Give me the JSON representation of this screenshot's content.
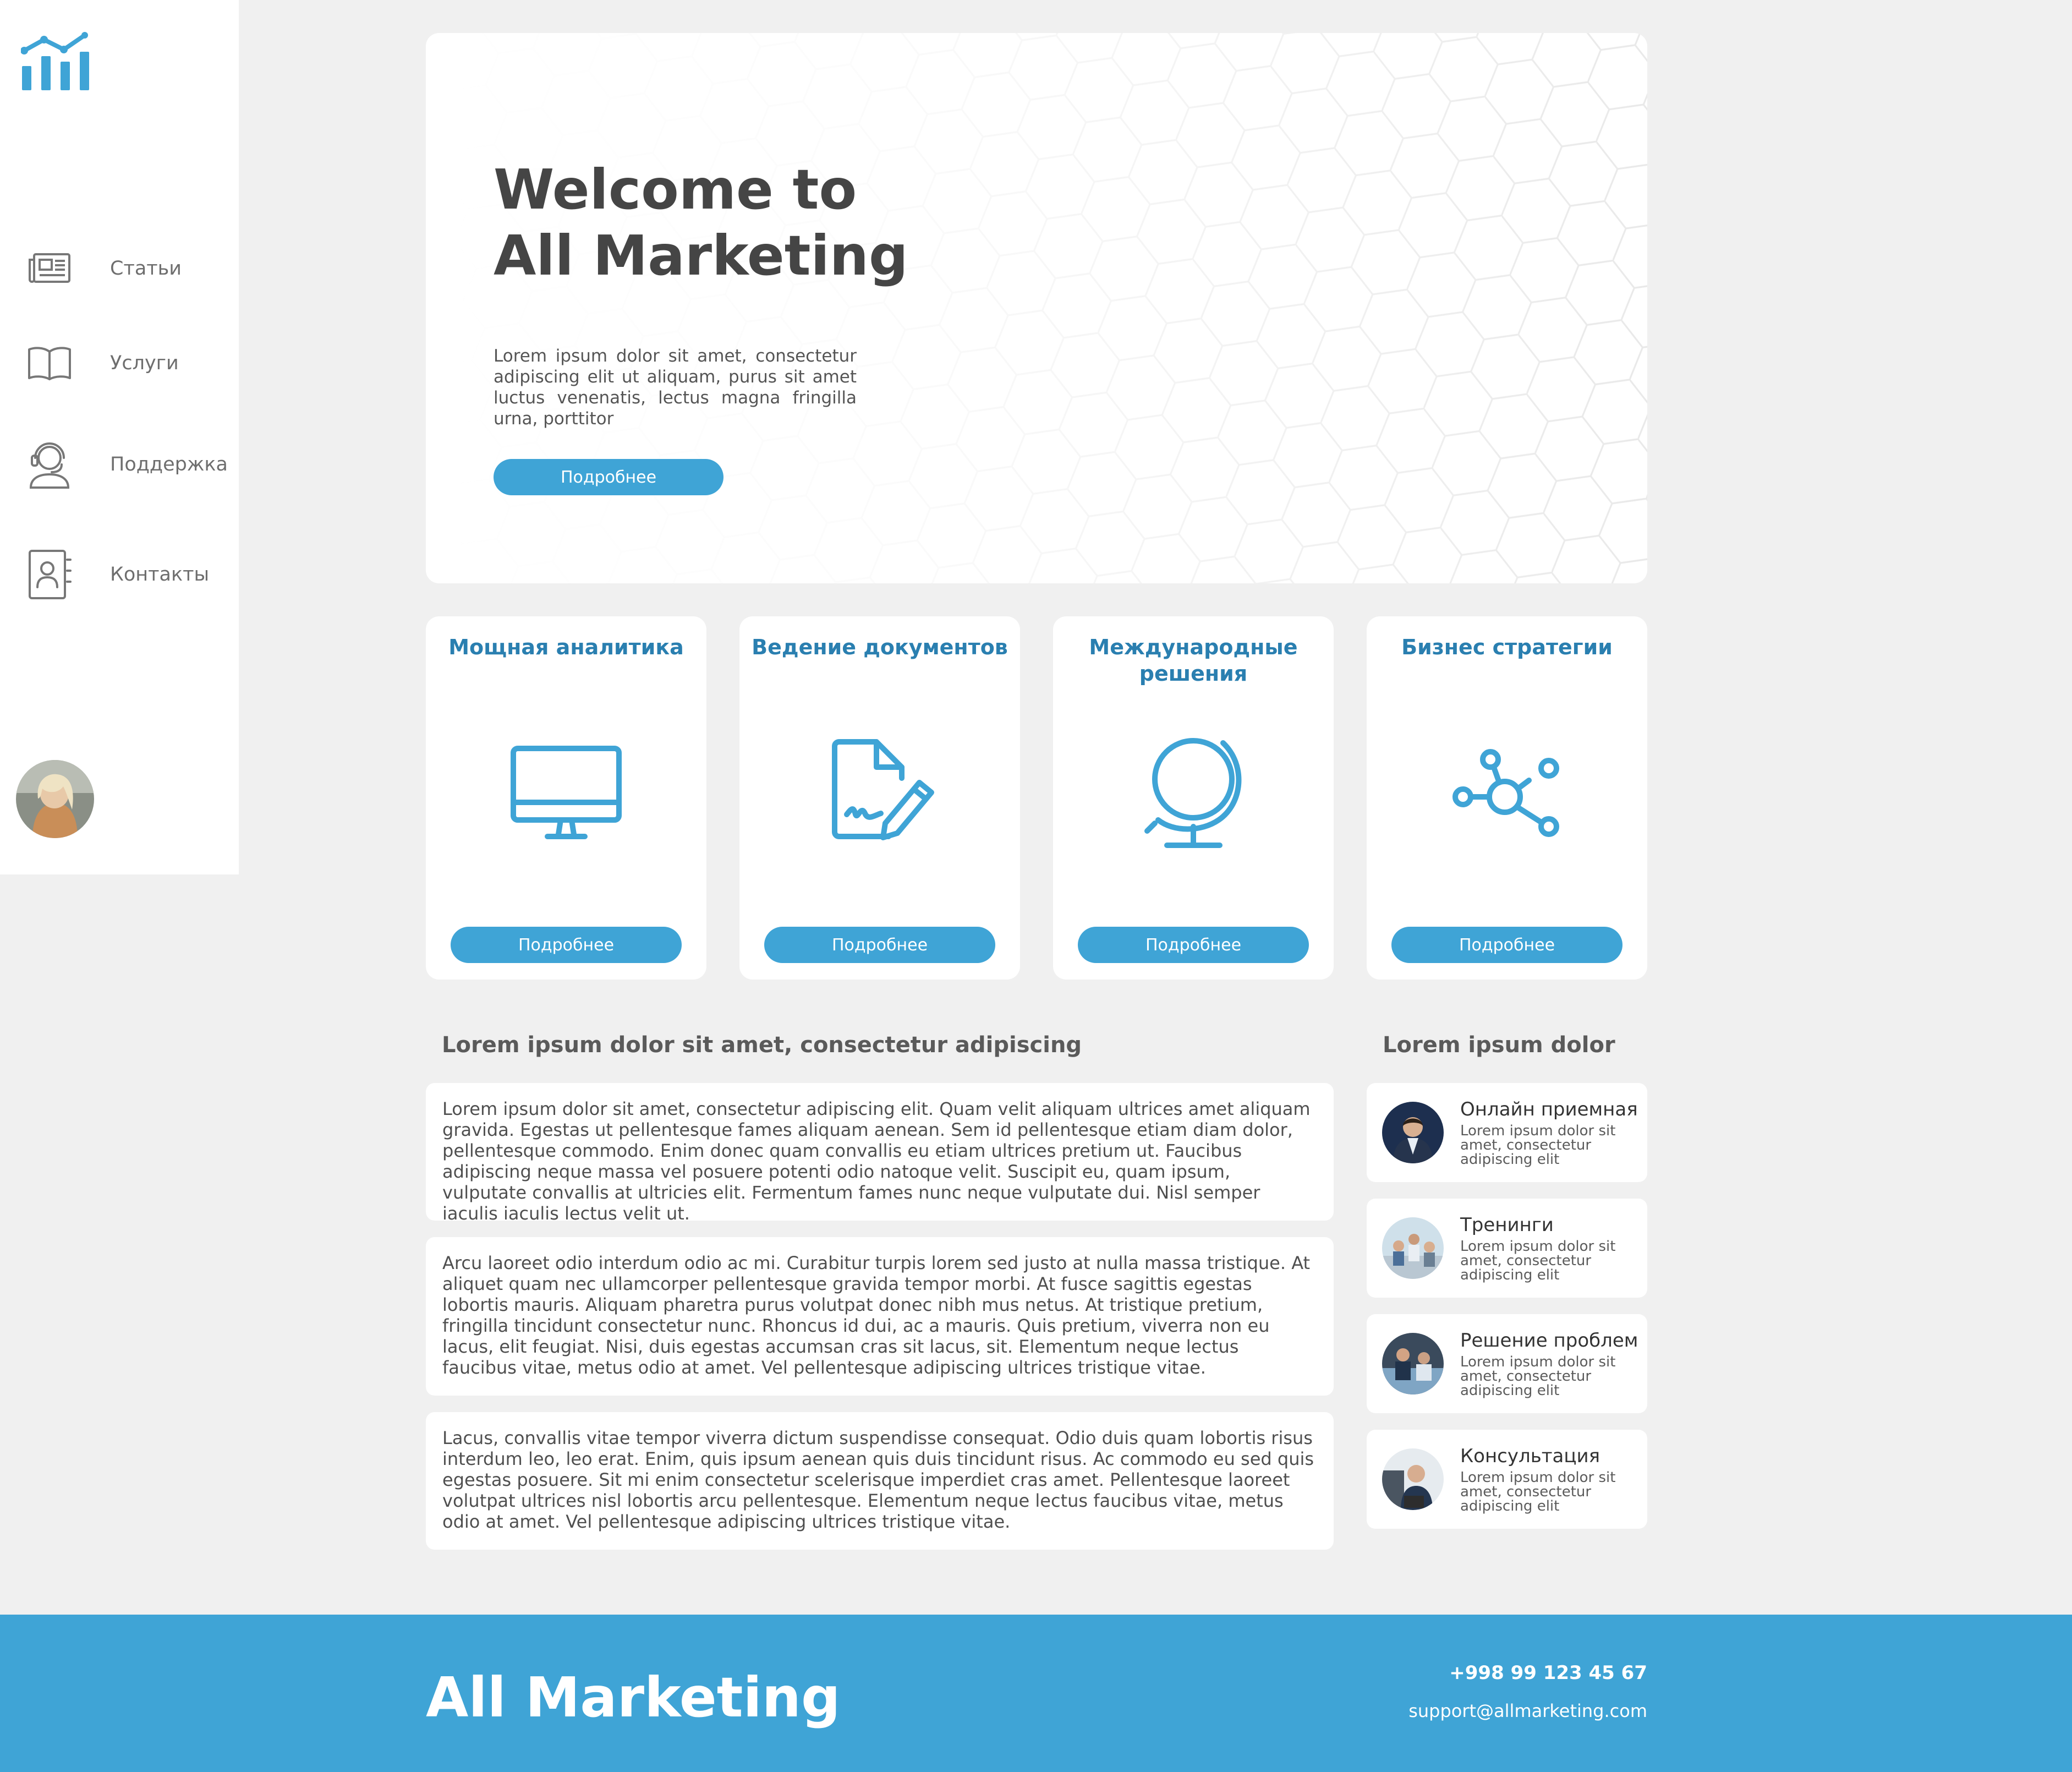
{
  "brand": {
    "logo_icon": "bar-chart-trend-icon",
    "accent_color": "#3fa4d6"
  },
  "sidebar": {
    "items": [
      {
        "label": "Статьи",
        "icon": "newspaper-icon"
      },
      {
        "label": "Услуги",
        "icon": "open-book-icon"
      },
      {
        "label": "Поддержка",
        "icon": "support-headset-icon"
      },
      {
        "label": "Контакты",
        "icon": "contacts-book-icon"
      }
    ],
    "avatar": "user-avatar"
  },
  "hero": {
    "title_line1": "Welcome to",
    "title_line2": "All Marketing",
    "text": "Lorem ipsum dolor sit amet, consectetur adipiscing elit ut aliquam, purus sit amet luctus venenatis, lectus magna fringilla urna, porttitor",
    "button": "Подробнее"
  },
  "services": [
    {
      "title": "Мощная аналитика",
      "icon": "monitor-icon",
      "button": "Подробнее"
    },
    {
      "title": "Ведение документов",
      "icon": "document-signature-icon",
      "button": "Подробнее"
    },
    {
      "title": "Международные решения",
      "icon": "globe-icon",
      "button": "Подробнее"
    },
    {
      "title": "Бизнес стратегии",
      "icon": "network-nodes-icon",
      "button": "Подробнее"
    }
  ],
  "articles": {
    "heading": "Lorem ipsum dolor sit amet, consectetur adipiscing",
    "paragraphs": [
      "Lorem ipsum dolor sit amet, consectetur adipiscing elit. Quam velit aliquam ultrices amet aliquam gravida. Egestas ut pellentesque fames aliquam aenean. Sem id pellentesque etiam diam dolor, pellentesque commodo. Enim donec quam convallis eu etiam ultrices pretium ut. Faucibus adipiscing neque massa vel posuere potenti odio natoque velit. Suscipit eu, quam ipsum, vulputate convallis at ultricies elit. Fermentum fames nunc neque vulputate dui. Nisl semper iaculis iaculis lectus velit ut.",
      "Arcu laoreet odio interdum odio ac mi. Curabitur turpis lorem sed justo at nulla massa tristique. At aliquet quam nec ullamcorper pellentesque gravida tempor morbi. At fusce sagittis egestas lobortis mauris. Aliquam pharetra purus volutpat donec nibh mus netus. At tristique pretium, fringilla tincidunt consectetur nunc. Rhoncus id dui, ac a mauris. Quis pretium, viverra non eu lacus, elit feugiat. Nisi, duis egestas accumsan cras sit lacus, sit. Elementum neque lectus faucibus vitae, metus odio at amet. Vel pellentesque adipiscing ultrices tristique vitae.",
      "Lacus, convallis vitae tempor viverra dictum suspendisse consequat. Odio duis quam lobortis risus interdum leo, leo erat. Enim, quis ipsum aenean quis duis tincidunt risus. Ac commodo eu sed quis egestas posuere. Sit mi enim consectetur scelerisque imperdiet cras amet. Pellentesque laoreet volutpat ultrices nisl lobortis arcu pellentesque. Elementum neque lectus faucibus vitae, metus odio at amet. Vel pellentesque adipiscing ultrices tristique vitae."
    ]
  },
  "side_list": {
    "heading": "Lorem ipsum dolor",
    "items": [
      {
        "title": "Онлайн приемная",
        "text": "Lorem ipsum dolor sit amet, consectetur adipiscing elit"
      },
      {
        "title": "Тренинги",
        "text": "Lorem ipsum dolor sit amet, consectetur adipiscing elit"
      },
      {
        "title": "Решение проблем",
        "text": "Lorem ipsum dolor sit amet, consectetur adipiscing elit"
      },
      {
        "title": "Консультация",
        "text": "Lorem ipsum dolor sit amet, consectetur adipiscing elit"
      }
    ]
  },
  "footer": {
    "brand": "All Marketing",
    "phone": "+998 99 123 45 67",
    "email": "support@allmarketing.com"
  }
}
